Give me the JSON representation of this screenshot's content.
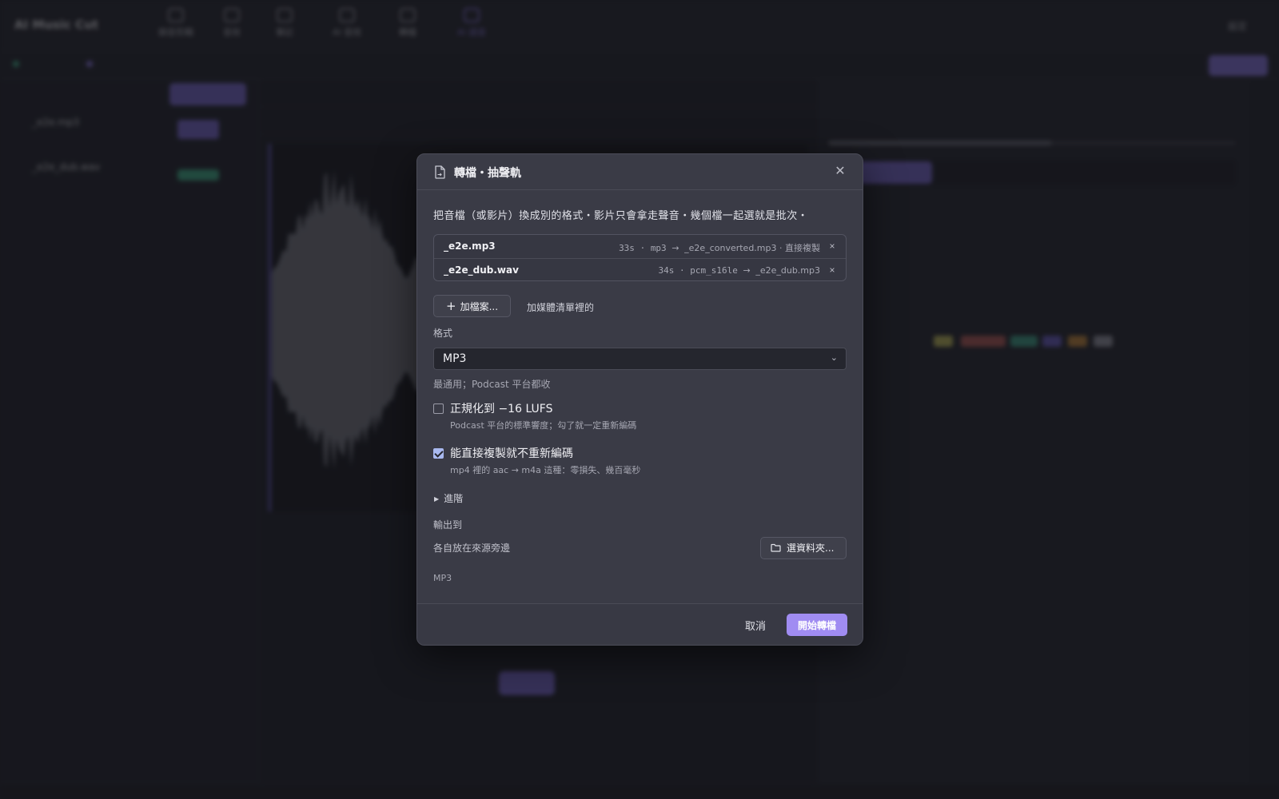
{
  "app": {
    "title": "AI Music Cut",
    "toolbar": [
      {
        "label": "錄音剪輯"
      },
      {
        "label": "音效"
      },
      {
        "label": "筆記"
      },
      {
        "label": "AI 音效"
      },
      {
        "label": "轉檔"
      },
      {
        "label": "AI 語音"
      }
    ],
    "top_right": "設定"
  },
  "modal": {
    "title": "轉檔・抽聲軌",
    "description": "把音檔（或影片）換成別的格式・影片只會拿走聲音・幾個檔一起選就是批次・",
    "files": [
      {
        "name": "_e2e.mp3",
        "duration": "33s",
        "codec": "mp3",
        "output": "_e2e_converted.mp3",
        "note": "直接複製"
      },
      {
        "name": "_e2e_dub.wav",
        "duration": "34s",
        "codec": "pcm_s16le",
        "output": "_e2e_dub.mp3",
        "note": ""
      }
    ],
    "separator": "·",
    "arrow": "→",
    "remove_symbol": "×",
    "add_files_label": "加檔案...",
    "add_from_media_label": "加媒體清單裡的",
    "format_label": "格式",
    "format_value": "MP3",
    "format_hint": "最通用；Podcast 平台都收",
    "normalize": {
      "checked": false,
      "label": "正規化到 −16 LUFS",
      "sub": "Podcast 平台的標準響度；勾了就一定重新編碼"
    },
    "stream_copy": {
      "checked": true,
      "label": "能直接複製就不重新編碼",
      "sub": "mp4 裡的 aac → m4a 這種：零損失、幾百毫秒"
    },
    "advanced_label": "進階",
    "output_label": "輸出到",
    "output_value": "各自放在來源旁邊",
    "choose_folder_label": "選資料夾...",
    "format_tag": "MP3",
    "cancel_label": "取消",
    "start_label": "開始轉檔"
  },
  "colors": {
    "accent": "#a08cf2",
    "modal_bg": "#3a3b46",
    "app_bg": "#1f2028"
  }
}
